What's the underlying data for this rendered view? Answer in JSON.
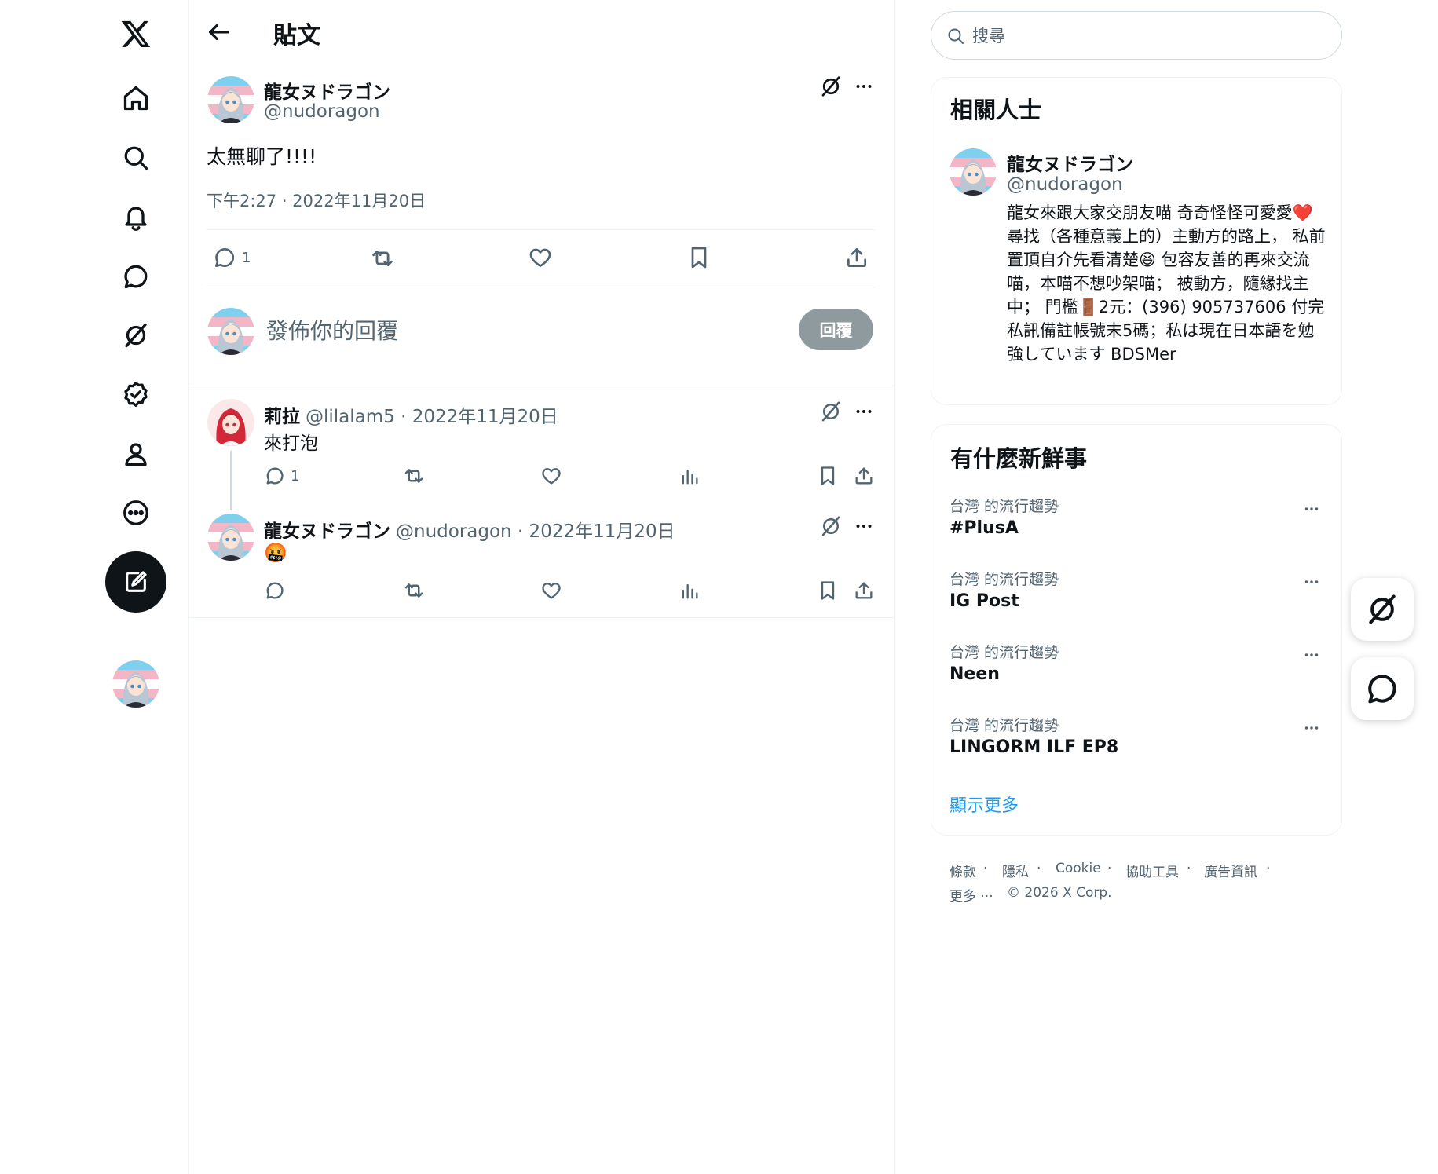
{
  "header": {
    "title": "貼文"
  },
  "search": {
    "placeholder": "搜尋"
  },
  "main_post": {
    "display_name": "龍女ヌドラゴン",
    "handle": "@nudoragon",
    "text": "太無聊了!!!!",
    "timestamp": "下午2:27 · 2022年11月20日",
    "reply_count": "1"
  },
  "composer": {
    "placeholder": "發佈你的回覆",
    "button_label": "回覆"
  },
  "replies": [
    {
      "display_name": "莉拉",
      "handle_time": "@lilalam5 · 2022年11月20日",
      "text": "來打泡",
      "reply_count": "1"
    },
    {
      "display_name": "龍女ヌドラゴン",
      "handle_time": "@nudoragon · 2022年11月20日",
      "text": "🤬",
      "reply_count": ""
    }
  ],
  "related": {
    "title": "相關人士",
    "display_name": "龍女ヌドラゴン",
    "handle": "@nudoragon",
    "bio": "龍女來跟大家交朋友喵 奇奇怪怪可愛愛❤️ 尋找（各種意義上的）主動方的路上， 私前置頂自介先看清楚😆 包容友善的再來交流喵，本喵不想吵架喵； 被動方，隨緣找主中； 門檻🚪2元：(396) 905737606 付完私訊備註帳號末5碼；私は現在日本語を勉強しています BDSMer"
  },
  "trends": {
    "title": "有什麼新鮮事",
    "items": [
      {
        "context": "台灣 的流行趨勢",
        "name": "#PlusA"
      },
      {
        "context": "台灣 的流行趨勢",
        "name": "IG Post"
      },
      {
        "context": "台灣 的流行趨勢",
        "name": "Neen"
      },
      {
        "context": "台灣 的流行趨勢",
        "name": "LINGORM ILF EP8"
      }
    ],
    "show_more": "顯示更多"
  },
  "footer": {
    "links": [
      "條款",
      "隱私",
      "Cookie",
      "協助工具",
      "廣告資訊",
      "更多 ···"
    ],
    "copyright": "© 2026 X Corp."
  },
  "colors": {
    "accent": "#1d9bf0",
    "text": "#0f1419",
    "muted": "#536471",
    "border": "#eff3f4"
  }
}
